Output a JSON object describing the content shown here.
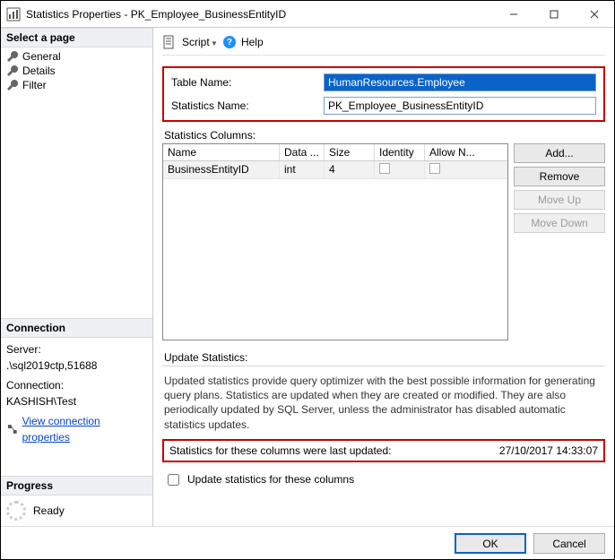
{
  "window": {
    "title": "Statistics Properties - PK_Employee_BusinessEntityID"
  },
  "sidebar": {
    "select_page_heading": "Select a page",
    "pages": [
      "General",
      "Details",
      "Filter"
    ],
    "connection_heading": "Connection",
    "server_label": "Server:",
    "server_value": ".\\sql2019ctp,51688",
    "connection_label": "Connection:",
    "connection_value": "KASHISH\\Test",
    "view_conn_link": "View connection properties",
    "progress_heading": "Progress",
    "progress_status": "Ready"
  },
  "toolbar": {
    "script_label": "Script",
    "help_label": "Help"
  },
  "form": {
    "table_name_label": "Table Name:",
    "table_name_value": "HumanResources.Employee",
    "stats_name_label": "Statistics Name:",
    "stats_name_value": "PK_Employee_BusinessEntityID",
    "stats_columns_label": "Statistics Columns:"
  },
  "grid": {
    "headers": {
      "name": "Name",
      "data_type": "Data ...",
      "size": "Size",
      "identity": "Identity",
      "allow_nulls": "Allow N..."
    },
    "rows": [
      {
        "name": "BusinessEntityID",
        "data_type": "int",
        "size": "4",
        "identity": false,
        "allow_nulls": false
      }
    ]
  },
  "buttons": {
    "add": "Add...",
    "remove": "Remove",
    "move_up": "Move Up",
    "move_down": "Move Down",
    "ok": "OK",
    "cancel": "Cancel"
  },
  "update": {
    "section_label": "Update Statistics:",
    "help_text": "Updated statistics provide query optimizer with the best possible information for generating query plans. Statistics are updated when they are created or modified. They are also periodically updated by SQL Server, unless the administrator has disabled automatic statistics updates.",
    "last_updated_label": "Statistics for these columns were last updated:",
    "last_updated_value": "27/10/2017 14:33:07",
    "checkbox_label": "Update statistics for these columns"
  }
}
